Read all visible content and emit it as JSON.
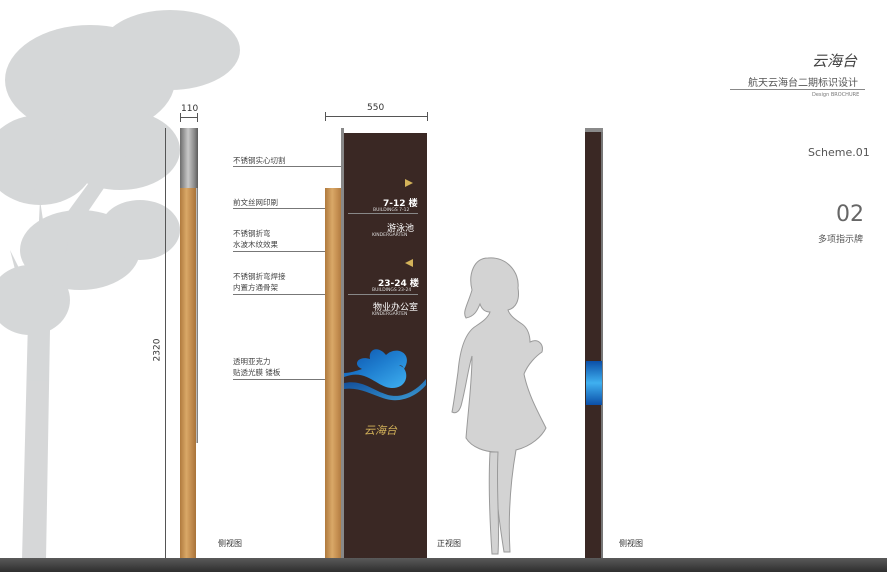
{
  "header": {
    "logo_text": "云海台",
    "title": "航天云海台二期标识设计",
    "subtitle": "Design BROCHURE",
    "scheme": "Scheme.01",
    "number": "02",
    "category": "多项指示牌"
  },
  "dimensions": {
    "side_width": "110",
    "front_width": "550",
    "height": "2320"
  },
  "annotations": [
    "不锈钢实心切割",
    "前文丝网印刷",
    "不锈钢折弯",
    "水波木纹效果",
    "不锈钢折弯焊接",
    "内置方通骨架",
    "透明亚克力",
    "贴透光膜 镂板"
  ],
  "sign": {
    "dir1_number": "7-12 楼",
    "dir1_sub": "BUILDINGS 7-12",
    "dir1_place": "游泳池",
    "dir1_place_en": "KINDERGARTEN",
    "dir2_number": "23-24 楼",
    "dir2_sub": "BUILDINGS 23-24",
    "dir2_place": "物业办公室",
    "dir2_place_en": "KINDERGARTEN",
    "logo": "云海台"
  },
  "views": {
    "left": "侧视图",
    "front": "正视图",
    "right": "侧视图"
  },
  "colors": {
    "panel": "#3a2824",
    "accent_gold": "#d4b35a",
    "wave_blue": "#1f7fd0"
  }
}
